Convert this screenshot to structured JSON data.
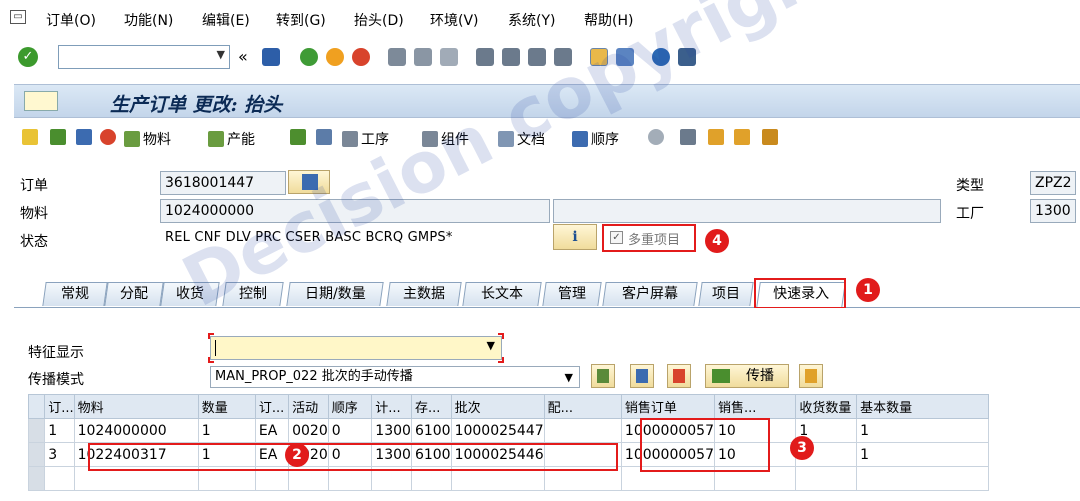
{
  "menu": {
    "items": [
      "订单(O)",
      "功能(N)",
      "编辑(E)",
      "转到(G)",
      "抬头(D)",
      "环境(V)",
      "系统(Y)",
      "帮助(H)"
    ]
  },
  "toolbar": {
    "command_value": "",
    "back_label": "«"
  },
  "title": "生产订单 更改: 抬头",
  "app_toolbar": {
    "material": "物料",
    "capacity": "产能",
    "operations": "工序",
    "components": "组件",
    "documents": "文档",
    "sequence": "顺序"
  },
  "header": {
    "order_label": "订单",
    "order_value": "3618001447",
    "material_label": "物料",
    "material_value": "1024000000",
    "material_desc": "",
    "status_label": "状态",
    "status_value": "REL  CNF  DLV  PRC  CSER BASC BCRQ GMPS*",
    "info_label": "i",
    "multi_label": "多重项目",
    "type_label": "类型",
    "type_value": "ZPZ2",
    "plant_label": "工厂",
    "plant_value": "1300"
  },
  "tabs": [
    "常规",
    "分配",
    "收货",
    "控制",
    "日期/数量",
    "主数据",
    "长文本",
    "管理",
    "客户屏幕",
    "项目",
    "快速录入"
  ],
  "quick": {
    "feature_label": "特征显示",
    "feature_value": "",
    "propagation_label": "传播模式",
    "propagation_value": "MAN_PROP_022 批次的手动传播",
    "propagate_button": "传播"
  },
  "table": {
    "headers": [
      "订...",
      "物料",
      "数量",
      "订...",
      "活动",
      "顺序",
      "计...",
      "存...",
      "批次",
      "配...",
      "销售订单",
      "销售...",
      "收货数量",
      "基本数量"
    ],
    "rows": [
      [
        "1",
        "1024000000",
        "1",
        "EA",
        "0020",
        "0",
        "1300",
        "6100",
        "1000025447",
        "",
        "1000000057",
        "10",
        "1",
        "1"
      ],
      [
        "3",
        "1022400317",
        "1",
        "EA",
        "0020",
        "0",
        "1300",
        "6100",
        "1000025446",
        "",
        "1000000057",
        "10",
        "1",
        "1"
      ]
    ]
  },
  "callouts": [
    "1",
    "2",
    "3",
    "4"
  ],
  "watermark": "Decision copyright",
  "colors": {
    "highlight_red": "#e31b1b",
    "title_blue": "#0b2a55",
    "tab_bg": "#d6e2ef"
  }
}
